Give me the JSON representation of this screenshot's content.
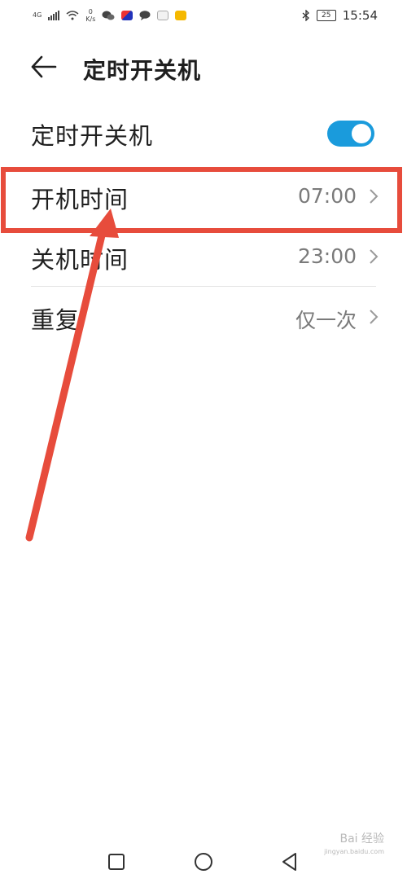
{
  "status_bar": {
    "network_tag": "4G",
    "speed_value": "0",
    "speed_unit": "K/s",
    "battery": "25",
    "time": "15:54"
  },
  "header": {
    "title": "定时开关机"
  },
  "settings": {
    "toggle": {
      "label": "定时开关机",
      "on": true
    },
    "power_on": {
      "label": "开机时间",
      "value": "07:00"
    },
    "power_off": {
      "label": "关机时间",
      "value": "23:00"
    },
    "repeat": {
      "label": "重复",
      "value": "仅一次"
    }
  },
  "watermark": {
    "text": "Bai 经验",
    "sub": "jingyan.baidu.com"
  },
  "colors": {
    "accent": "#1a9bdc",
    "annotation": "#e74c3c",
    "text": "#1f1f1f",
    "secondary_text": "#7a7a7a"
  },
  "icons": {
    "back": "arrow-left-icon",
    "chevron": "chevron-right-icon",
    "nav_recents": "square-icon",
    "nav_home": "circle-icon",
    "nav_back": "triangle-left-icon"
  }
}
